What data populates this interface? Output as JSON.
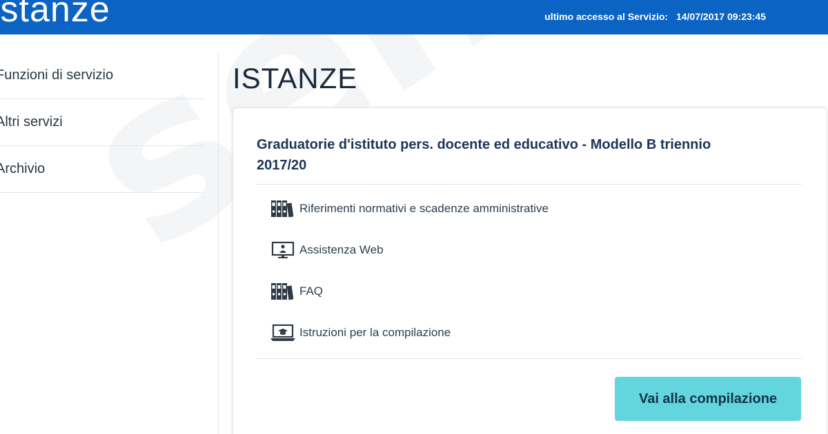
{
  "header": {
    "app_title": "istanze",
    "last_access_label": "ultimo accesso al Servizio:",
    "last_access_value": "14/07/2017 09:23:45",
    "bg_color": "#0b63c4"
  },
  "sidebar": {
    "items": [
      {
        "label": "Funzioni di servizio"
      },
      {
        "label": "Altri servizi"
      },
      {
        "label": "Archivio"
      }
    ]
  },
  "main": {
    "title": "ISTANZE",
    "card": {
      "title": "Graduatorie d'istituto pers. docente ed educativo - Modello B triennio 2017/20",
      "links": [
        {
          "label": "Riferimenti normativi e scadenze amministrative",
          "icon": "binders-icon"
        },
        {
          "label": "Assistenza Web",
          "icon": "monitor-user-icon"
        },
        {
          "label": "FAQ",
          "icon": "binders-icon"
        },
        {
          "label": "Istruzioni per la compilazione",
          "icon": "laptop-graduation-icon"
        }
      ],
      "cta_label": "Vai alla compilazione",
      "cta_color": "#62d6dc"
    }
  },
  "watermark": {
    "text": "senex.it"
  }
}
